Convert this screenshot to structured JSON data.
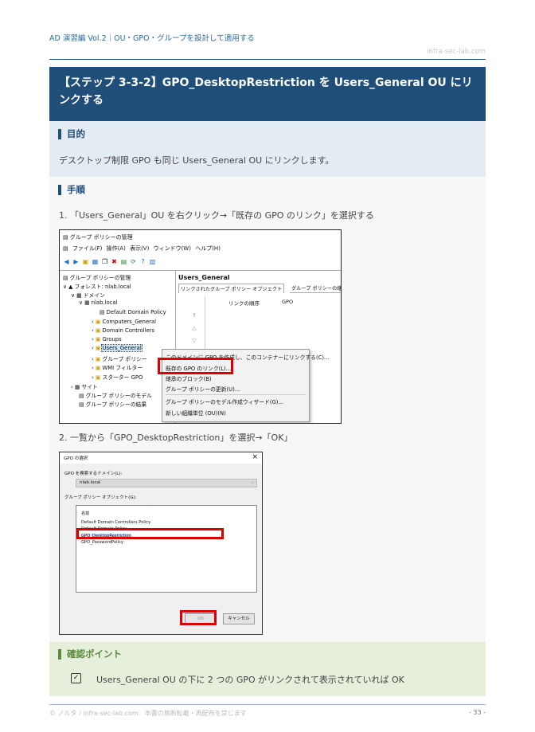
{
  "header": {
    "doc_title": "AD 演習編 Vol.2｜OU・GPO・グループを設計して適用する",
    "site": "infra-sec-lab.com"
  },
  "step": {
    "title": "【ステップ 3-3-2】GPO_DesktopRestriction を Users_General OU にリンクする"
  },
  "purpose": {
    "heading": "目的",
    "text": "デスクトップ制限 GPO も同じ Users_General OU にリンクします。"
  },
  "procedure": {
    "heading": "手順",
    "step1": "1. 「Users_General」OU を右クリック→「既存の GPO のリンク」を選択する",
    "step2": "2. 一覧から「GPO_DesktopRestriction」を選択→「OK」"
  },
  "screenshot1": {
    "window_title": "グループ ポリシーの管理",
    "menu": [
      "ファイル(F)",
      "操作(A)",
      "表示(V)",
      "ウィンドウ(W)",
      "ヘルプ(H)"
    ],
    "tree": {
      "root": "グループ ポリシーの管理",
      "forest": "フォレスト: nlab.local",
      "domains": "ドメイン",
      "domain": "nlab.local",
      "items": [
        "Default Domain Policy",
        "Computers_General",
        "Domain Controllers",
        "Groups",
        "Users_General",
        "グループ ポリシー",
        "WMI フィルター",
        "スターター GPO"
      ],
      "sites": "サイト",
      "modeling": "グループ ポリシーのモデル",
      "results": "グループ ポリシーの結果"
    },
    "right_pane": {
      "title": "Users_General",
      "tab1": "リンクされたグループ ポリシー オブジェクト",
      "tab2": "グループ ポリシーの継",
      "col1": "リンクの順序",
      "col2": "GPO"
    },
    "context_menu": [
      "このドメインに GPO を作成し、このコンテナーにリンクする(C)...",
      "既存の GPO のリンク(L)...",
      "継承のブロック(B)",
      "グループ ポリシーの更新(U)...",
      "グループ ポリシーのモデル作成ウィザード(G)...",
      "新しい組織単位 (OU)(N)"
    ]
  },
  "screenshot2": {
    "title": "GPO の選択",
    "close": "×",
    "domain_label": "GPO を検索するドメイン(L):",
    "domain_value": "nlab.local",
    "list_label": "グループ ポリシー オブジェクト(G):",
    "col_header": "名前",
    "rows": [
      "Default Domain Controllers Policy",
      "Default Domain Policy",
      "GPO_DesktopRestriction",
      "GPO_PasswordPolicy"
    ],
    "ok": "OK",
    "cancel": "キャンセル"
  },
  "confirm": {
    "heading": "確認ポイント",
    "item": "Users_General OU の下に 2 つの GPO がリンクされて表示されていれば OK"
  },
  "footer": {
    "copyright": "© ノルタ / infra-sec-lab.com　本書の無断転載・再配布を禁じます",
    "page": "- 33 -"
  }
}
